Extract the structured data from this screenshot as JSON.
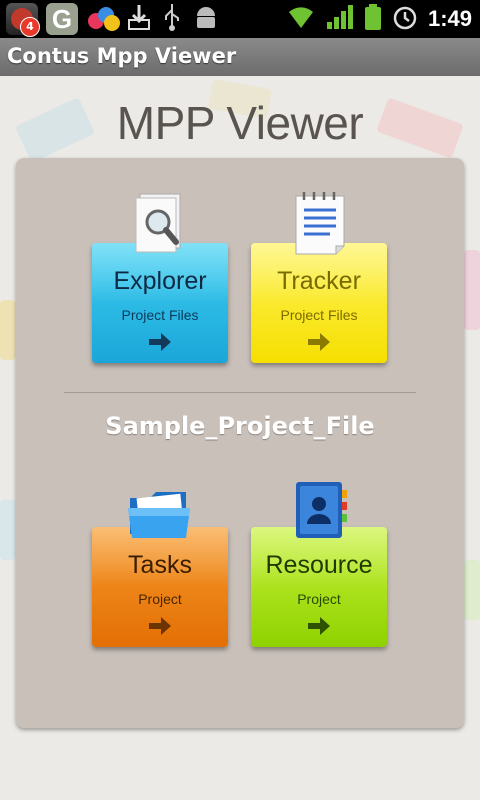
{
  "status_bar": {
    "notification_count": "4",
    "time": "1:49"
  },
  "app_bar": {
    "title": "Contus Mpp Viewer"
  },
  "header": {
    "logo_text": "MPP Viewer"
  },
  "project": {
    "name": "Sample_Project_File"
  },
  "tiles": [
    {
      "label": "Explorer",
      "sub": "Project Files",
      "color": "#29BCE8",
      "icon": "magnifier-document-icon"
    },
    {
      "label": "Tracker",
      "sub": "Project Files",
      "color": "#F9E81C",
      "icon": "notepad-icon"
    },
    {
      "label": "Tasks",
      "sub": "Project",
      "color": "#EE8416",
      "icon": "folder-icon"
    },
    {
      "label": "Resource",
      "sub": "Project",
      "color": "#A9E51A",
      "icon": "contacts-book-icon"
    }
  ]
}
